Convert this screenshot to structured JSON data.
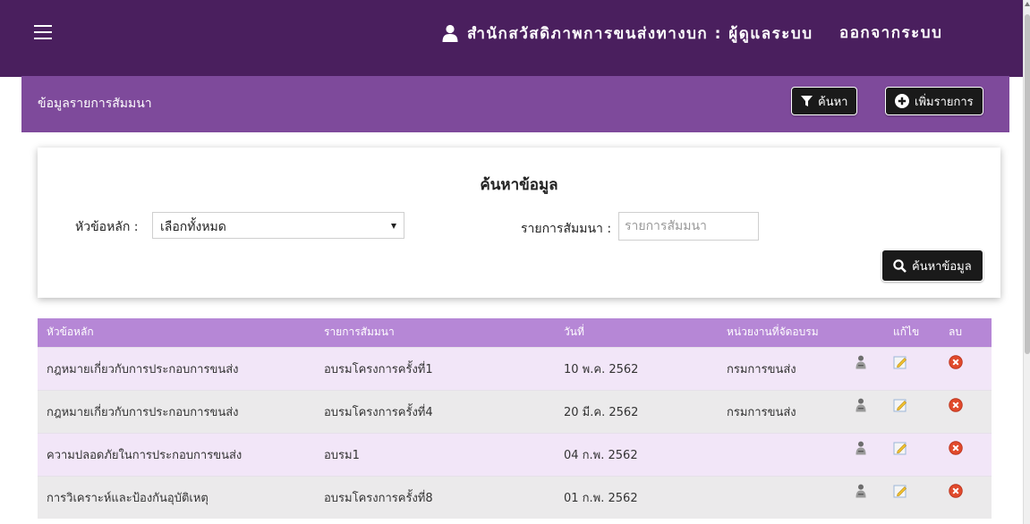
{
  "header": {
    "menu_icon": "hamburger-icon",
    "user_icon": "user-icon",
    "system_title": "สำนักสวัสดิภาพการขนส่งทางบก : ผู้ดูแลระบบ",
    "logout_label": "ออกจากระบบ"
  },
  "panel": {
    "title": "ข้อมูลรายการสัมมนา",
    "search_button": {
      "icon": "filter-icon",
      "label": "ค้นหา"
    },
    "add_button": {
      "icon": "plus-circle-icon",
      "label": "เพิ่มรายการ"
    }
  },
  "search": {
    "title": "ค้นหาข้อมูล",
    "topic_label": "หัวข้อหลัก :",
    "topic_value": "เลือกทั้งหมด",
    "seminar_label": "รายการสัมมนา :",
    "seminar_placeholder": "รายการสัมมนา",
    "submit_label": "ค้นหาข้อมูล",
    "submit_icon": "search-icon"
  },
  "table": {
    "headers": {
      "topic": "หัวข้อหลัก",
      "seminar": "รายการสัมมนา",
      "date": "วันที่",
      "org": "หน่วยงานที่จัดอบรม",
      "users": "",
      "edit": "แก้ไข",
      "delete": "ลบ"
    },
    "rows": [
      {
        "topic": "กฎหมายเกี่ยวกับการประกอบการขนส่ง",
        "seminar": "อบรมโครงการครั้งที่1",
        "date": "10 พ.ค. 2562",
        "org": "กรมการขนส่ง"
      },
      {
        "topic": "กฎหมายเกี่ยวกับการประกอบการขนส่ง",
        "seminar": "อบรมโครงการครั้งที่4",
        "date": "20 มี.ค. 2562",
        "org": "กรมการขนส่ง"
      },
      {
        "topic": "ความปลอดภัยในการประกอบการขนส่ง",
        "seminar": "อบรม1",
        "date": "04 ก.พ. 2562",
        "org": ""
      },
      {
        "topic": "การวิเคราะห์และป้องกันอุบัติเหตุ",
        "seminar": "อบรมโครงการครั้งที่8",
        "date": "01 ก.พ. 2562",
        "org": ""
      }
    ],
    "row_icons": {
      "users": "users-icon",
      "edit": "edit-icon",
      "delete": "delete-icon"
    }
  },
  "colors": {
    "topbar": "#4a1f5e",
    "panel_header": "#7e4a9b",
    "table_header": "#b687d6",
    "row_highlight": "#f2e6f8",
    "row_alt": "#ebeaeb"
  }
}
